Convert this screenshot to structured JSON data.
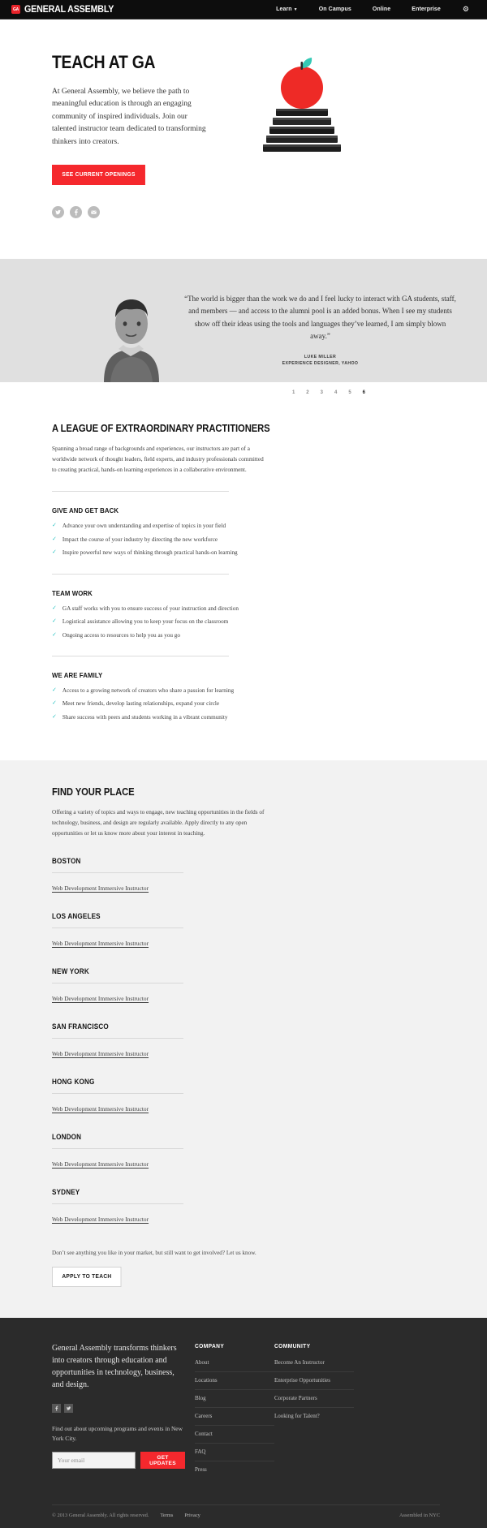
{
  "header": {
    "logo_badge": "GA",
    "logo_text": "GENERAL ASSEMBLY",
    "nav": [
      {
        "label": "Learn",
        "has_caret": true
      },
      {
        "label": "On Campus",
        "has_caret": false
      },
      {
        "label": "Online",
        "has_caret": false
      },
      {
        "label": "Enterprise",
        "has_caret": false
      }
    ],
    "gear_icon": "gear-icon"
  },
  "hero": {
    "title": "TEACH AT GA",
    "body": "At General Assembly, we believe the path to meaningful education is through an engaging community of inspired individuals. Join our talented instructor team dedicated to transforming thinkers into creators.",
    "cta": "SEE CURRENT OPENINGS",
    "socials": [
      "twitter-icon",
      "facebook-icon",
      "email-icon"
    ],
    "illustration": "apple-on-books-illustration"
  },
  "testimonial": {
    "quote": "“The world is bigger than the work we do and I feel lucky to interact with GA students, staff, and members — and access to the alumni pool is an added bonus. When I see my students show off their ideas using the tools and languages they’ve learned, I am simply blown away.”",
    "author": "LUKE MILLER",
    "role": "EXPERIENCE DESIGNER, YAHOO",
    "photo": "instructor-portrait",
    "pages": [
      "1",
      "2",
      "3",
      "4",
      "5",
      "6"
    ],
    "active_page": "6"
  },
  "practitioners": {
    "heading": "A LEAGUE OF EXTRAORDINARY PRACTITIONERS",
    "intro": "Spanning a broad range of backgrounds and experiences, our instructors are part of a worldwide network of thought leaders, field experts, and industry professionals committed to creating practical, hands-on learning experiences in a collaborative environment.",
    "groups": [
      {
        "title": "GIVE AND GET BACK",
        "items": [
          "Advance your own understanding and expertise of topics in your field",
          "Impact the course of your industry by directing the new workforce",
          "Inspire powerful new ways of thinking through practical hands-on learning"
        ]
      },
      {
        "title": "TEAM WORK",
        "items": [
          "GA staff works with you to ensure success of your instruction and direction",
          "Logistical assistance allowing you to keep your focus on the classroom",
          "Ongoing access to resources to help you as you go"
        ]
      },
      {
        "title": "WE ARE FAMILY",
        "items": [
          "Access to a growing network of creators who share a passion for learning",
          "Meet new friends, develop lasting relationships, expand your circle",
          "Share success with peers and students working in a vibrant community"
        ]
      }
    ]
  },
  "places": {
    "heading": "FIND YOUR PLACE",
    "intro": "Offering a variety of topics and ways to engage, new teaching opportunities in the fields of technology, business, and design are regularly available. Apply directly to any open opportunities or let us know more about your interest in teaching.",
    "cities": [
      {
        "name": "BOSTON",
        "job": "Web Development Immersive Instructor"
      },
      {
        "name": "LOS ANGELES",
        "job": "Web Development Immersive Instructor"
      },
      {
        "name": "NEW YORK",
        "job": "Web Development Immersive Instructor"
      },
      {
        "name": "SAN FRANCISCO",
        "job": "Web Development Immersive Instructor"
      },
      {
        "name": "HONG KONG",
        "job": "Web Development Immersive Instructor"
      },
      {
        "name": "LONDON",
        "job": "Web Development Immersive Instructor"
      },
      {
        "name": "SYDNEY",
        "job": "Web Development Immersive Instructor"
      }
    ],
    "note": "Don’t see anything you like in your market, but still want to get involved? Let us know.",
    "cta": "APPLY TO TEACH"
  },
  "footer": {
    "lead": "General Assembly transforms thinkers into creators through education and opportunities in technology, business, and design.",
    "socials": [
      "facebook-icon",
      "twitter-icon"
    ],
    "subscribe_text": "Find out about upcoming programs and events in New York City.",
    "email_placeholder": "Your email",
    "email_value": "",
    "subscribe_button": "GET UPDATES",
    "columns": [
      {
        "title": "COMPANY",
        "links": [
          "About",
          "Locations",
          "Blog",
          "Careers",
          "Contact",
          "FAQ",
          "Press"
        ]
      },
      {
        "title": "COMMUNITY",
        "links": [
          "Become An Instructor",
          "Enterprise Opportunities",
          "Corporate Partners",
          "Looking for Talent?"
        ]
      }
    ],
    "copyright": "© 2013 General Assembly. All rights reserved.",
    "legal_links": [
      "Terms",
      "Privacy"
    ],
    "assembled": "Assembled in NYC"
  },
  "colors": {
    "brand_red": "#f5282d",
    "header_black": "#0d0d0d",
    "check_teal": "#2ec4c4",
    "footer_dark": "#2b2b2b",
    "testimonial_gray": "#e0e0e0",
    "places_gray": "#f2f2f2"
  }
}
